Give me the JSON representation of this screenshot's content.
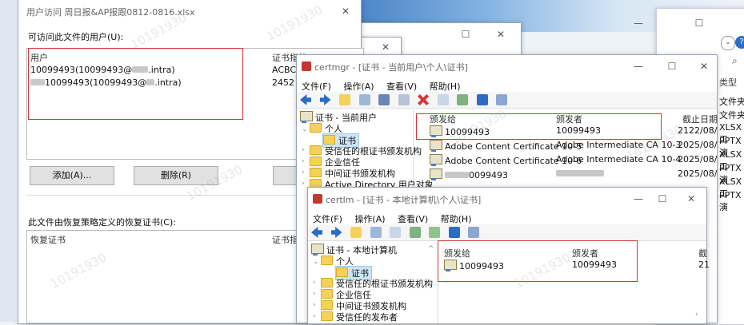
{
  "desktop": {
    "sky_color": "#4a86c8"
  },
  "explorer": {
    "type_header": "类型",
    "type_items": [
      "文件夹",
      "文件夹",
      "XLSX 工",
      "PPTX 演",
      "XLSX 工",
      "PPTX 演",
      "XLSX 工",
      "PPTX 演"
    ],
    "search_glyph": "⌕"
  },
  "access_dialog": {
    "title": "用户访问 周日报&AP报跟0812-0816.xlsx",
    "users_label": "可访问此文件的用户(U):",
    "col_user": "用户",
    "col_thumb": "证书指纹",
    "users": [
      {
        "name": "10099493(10099493@",
        "suffix": ".intra)",
        "thumb": "ACBC E"
      },
      {
        "name": "10099493(10099493@",
        "suffix": ".intra)",
        "thumb": "2452 1"
      }
    ],
    "add_button": "添加(A)...",
    "remove_button": "删除(R)",
    "backup_button": "备",
    "recovery_label": "此文件由恢复策略定义的恢复证书(C):",
    "recovery_col": "恢复证书",
    "recovery_thumb_col": "证书指纹"
  },
  "certmgr": {
    "title": "certmgr - [证书 - 当前用户\\个人\\证书]",
    "menu": [
      "文件(F)",
      "操作(A)",
      "查看(V)",
      "帮助(H)"
    ],
    "tree": {
      "root": "证书 - 当前用户",
      "personal": "个人",
      "certs": "证书",
      "trusted_root": "受信任的根证书颁发机构",
      "enterprise": "企业信任",
      "intermediate": "中间证书颁发机构",
      "ad_user": "Active Directory 用户对象"
    },
    "columns": {
      "issued_to": "颁发给",
      "issued_by": "颁发者",
      "expiry": "截止日期"
    },
    "rows": [
      {
        "issued_to": "10099493",
        "issued_by": "10099493",
        "expiry": "2122/08/"
      },
      {
        "issued_to": "Adobe Content Certificate 10-5",
        "issued_by": "Adobe Intermediate CA 10-3",
        "expiry": "2025/08/"
      },
      {
        "issued_to": "Adobe Content Certificate 10-6",
        "issued_by": "Adobe Intermediate CA 10-4",
        "expiry": "2025/08/"
      },
      {
        "issued_to": "0099493",
        "issued_by": "",
        "expiry": "2025/08/"
      }
    ]
  },
  "certlm": {
    "title": "certlm - [证书 - 本地计算机\\个人\\证书]",
    "menu": [
      "文件(F)",
      "操作(A)",
      "查看(V)",
      "帮助(H)"
    ],
    "tree": {
      "root": "证书 - 本地计算机",
      "personal": "个人",
      "certs": "证书",
      "trusted_root": "受信任的根证书颁发机构",
      "enterprise": "企业信任",
      "intermediate": "中间证书颁发机构",
      "trusted_publisher": "受信任的发布者"
    },
    "columns": {
      "issued_to": "颁发给",
      "issued_by": "颁发者",
      "expiry": "截"
    },
    "rows": [
      {
        "issued_to": "10099493",
        "issued_by": "10099493",
        "expiry": "21"
      }
    ]
  },
  "caption": {
    "minimize": "—",
    "maximize": "☐",
    "close": "✕"
  },
  "watermark": "10191930",
  "colors": {
    "highlight": "#d4363b",
    "accent_blue": "#2b6cc4"
  }
}
